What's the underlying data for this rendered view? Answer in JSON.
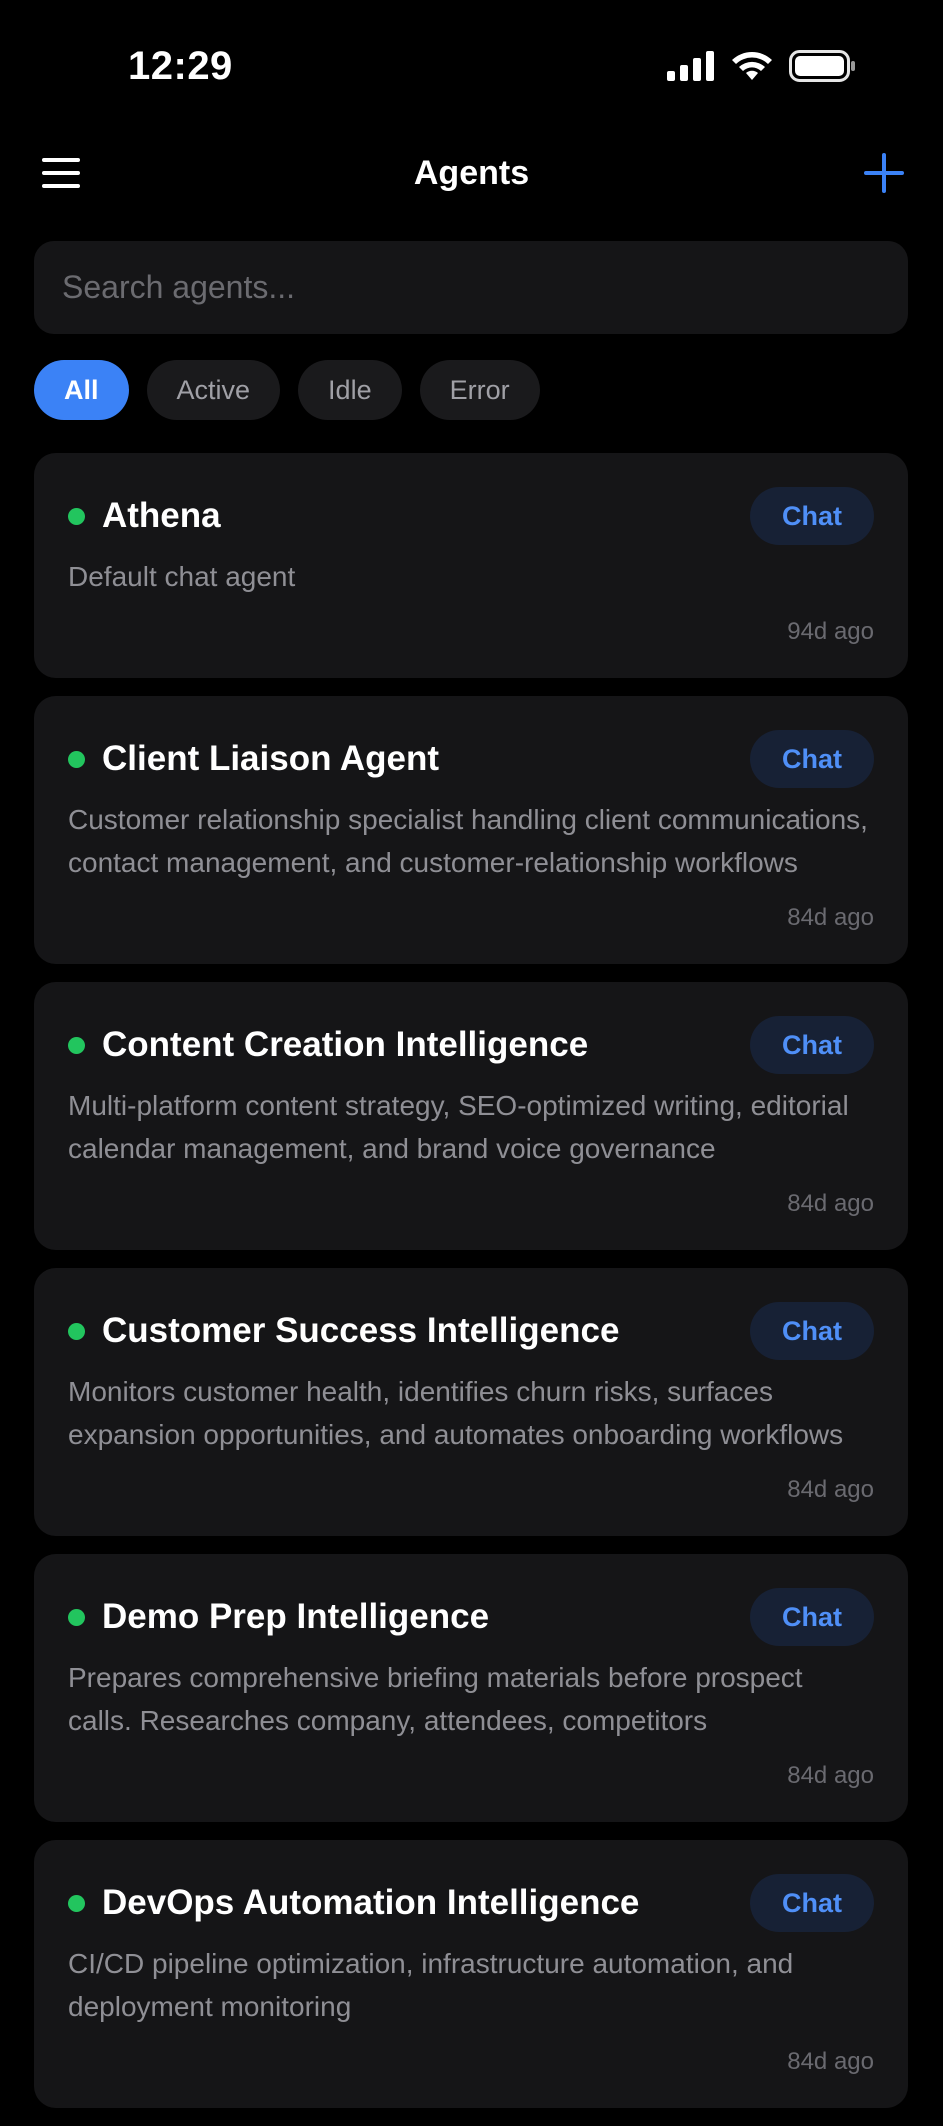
{
  "status_bar": {
    "time": "12:29",
    "icons": [
      "signal-icon",
      "wifi-icon",
      "battery-icon"
    ]
  },
  "nav": {
    "title": "Agents",
    "menu_icon": "hamburger-menu-icon",
    "add_icon": "plus-icon"
  },
  "search": {
    "placeholder": "Search agents...",
    "value": ""
  },
  "filters": [
    {
      "label": "All",
      "active": true
    },
    {
      "label": "Active",
      "active": false
    },
    {
      "label": "Idle",
      "active": false
    },
    {
      "label": "Error",
      "active": false
    }
  ],
  "agents": [
    {
      "name": "Athena",
      "description": "Default chat agent",
      "time": "94d ago",
      "chat_label": "Chat",
      "status_color": "#22c55e"
    },
    {
      "name": "Client Liaison Agent",
      "description": "Customer relationship specialist handling client communications, contact management, and customer-relationship workflows",
      "time": "84d ago",
      "chat_label": "Chat",
      "status_color": "#22c55e"
    },
    {
      "name": "Content Creation Intelligence",
      "description": "Multi-platform content strategy, SEO-optimized writing, editorial calendar management, and brand voice governance",
      "time": "84d ago",
      "chat_label": "Chat",
      "status_color": "#22c55e"
    },
    {
      "name": "Customer Success Intelligence",
      "description": "Monitors customer health, identifies churn risks, surfaces expansion opportunities, and automates onboarding workflows",
      "time": "84d ago",
      "chat_label": "Chat",
      "status_color": "#22c55e"
    },
    {
      "name": "Demo Prep Intelligence",
      "description": "Prepares comprehensive briefing materials before prospect calls. Researches company, attendees, competitors",
      "time": "84d ago",
      "chat_label": "Chat",
      "status_color": "#22c55e"
    },
    {
      "name": "DevOps Automation Intelligence",
      "description": "CI/CD pipeline optimization, infrastructure automation, and deployment monitoring",
      "time": "84d ago",
      "chat_label": "Chat",
      "status_color": "#22c55e"
    }
  ],
  "colors": {
    "accent": "#3b82f6",
    "chat_text": "#4f8ff7",
    "status_active": "#22c55e",
    "card_bg": "#151517"
  }
}
